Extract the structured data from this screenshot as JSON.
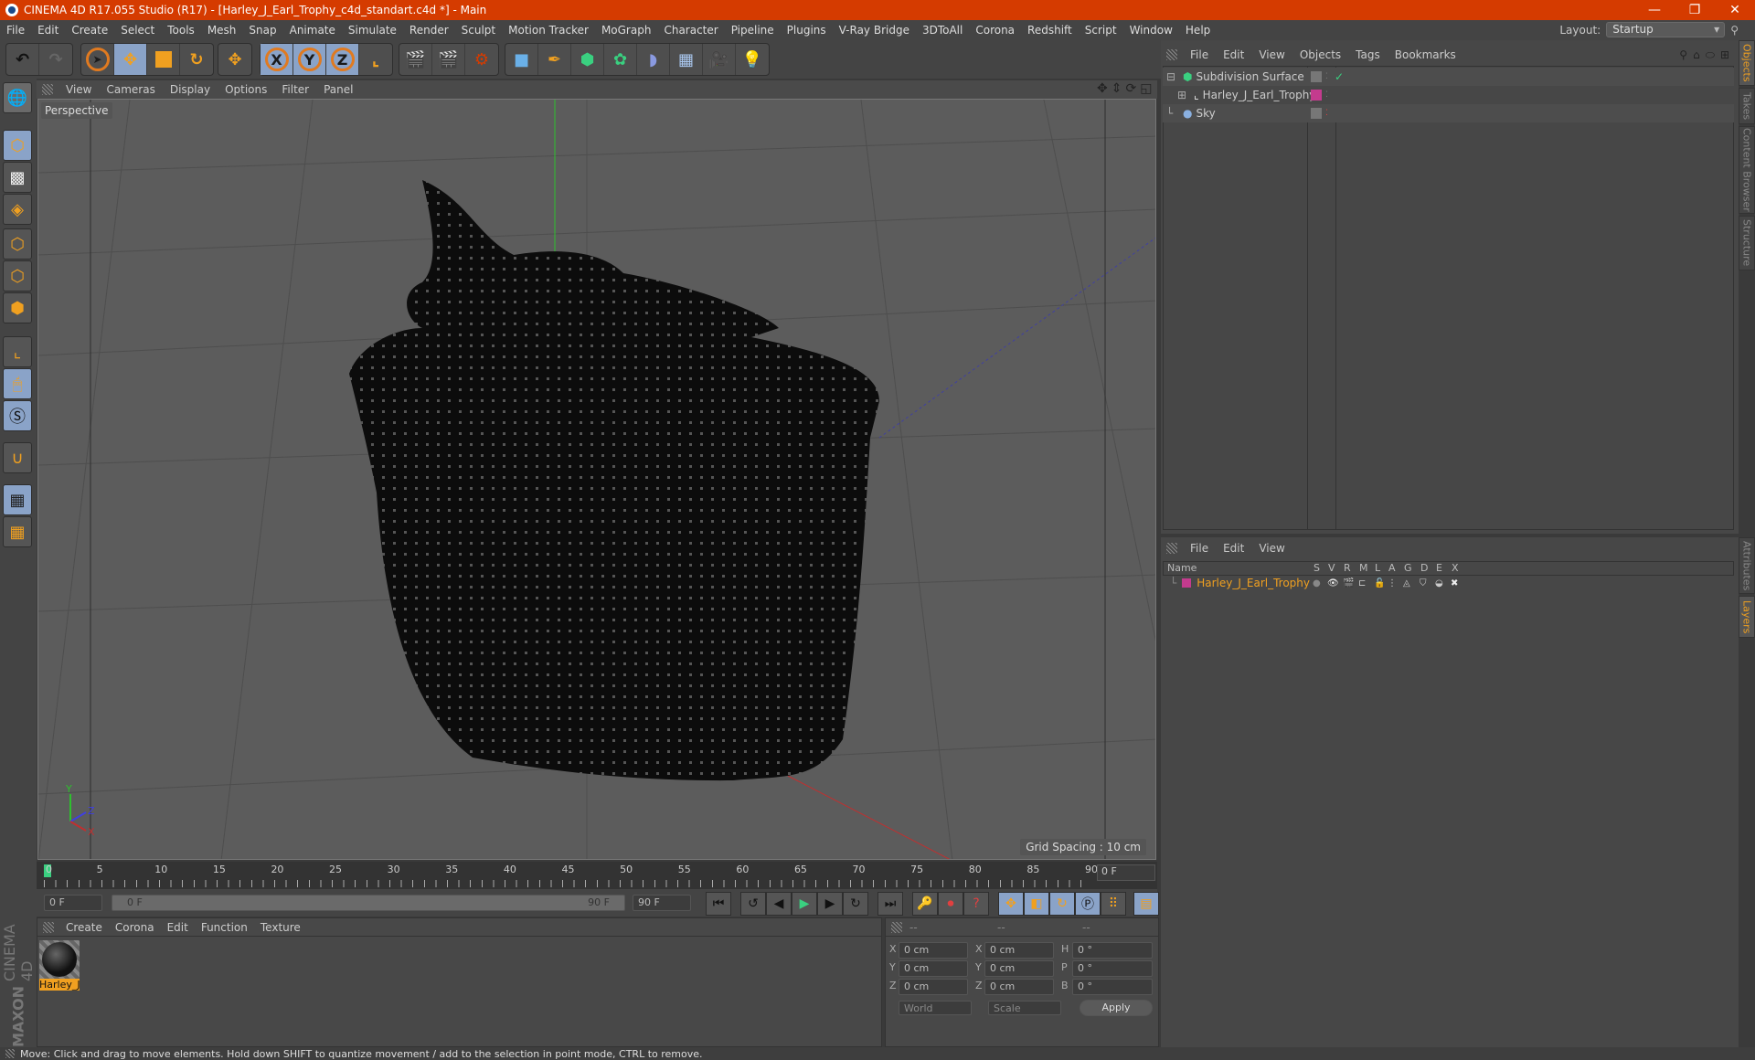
{
  "window": {
    "title": "CINEMA 4D R17.055 Studio (R17) - [Harley_J_Earl_Trophy_c4d_standart.c4d *] - Main",
    "controls": [
      "minimize",
      "restore",
      "close"
    ]
  },
  "menubar": [
    "File",
    "Edit",
    "Create",
    "Select",
    "Tools",
    "Mesh",
    "Snap",
    "Animate",
    "Simulate",
    "Render",
    "Sculpt",
    "Motion Tracker",
    "MoGraph",
    "Character",
    "Pipeline",
    "Plugins",
    "V-Ray Bridge",
    "3DToAll",
    "Corona",
    "Redshift",
    "Script",
    "Window",
    "Help"
  ],
  "layout": {
    "label": "Layout:",
    "value": "Startup"
  },
  "toolbar": {
    "history": [
      "undo-icon",
      "redo-icon"
    ],
    "modes": [
      "live-select-icon",
      "move-icon",
      "scale-icon",
      "rotate-icon",
      "transform-icon"
    ],
    "axes": [
      "X",
      "Y",
      "Z",
      "world-coordinate-icon"
    ],
    "render": [
      "render-view-icon",
      "render-picture-viewer-icon",
      "render-settings-icon"
    ],
    "create": [
      "cube-icon",
      "pen-icon",
      "subdivision-icon",
      "array-icon",
      "deformer-icon",
      "floor-icon",
      "camera-icon",
      "light-icon"
    ]
  },
  "left_tools": [
    "make-editable-icon",
    "model-mode-icon",
    "texture-mode-icon",
    "workplane-icon",
    "points-mode-icon",
    "edges-mode-icon",
    "polygons-mode-icon",
    "axis-icon",
    "tweak-icon",
    "solo-icon",
    "magnet-icon",
    "lock-workplane-icon",
    "snap-workplane-icon"
  ],
  "viewport": {
    "menu": [
      "View",
      "Cameras",
      "Display",
      "Options",
      "Filter",
      "Panel"
    ],
    "camera_label": "Perspective",
    "grid_spacing": "Grid Spacing : 10 cm",
    "axis_labels": [
      "Y",
      "Z",
      "X"
    ]
  },
  "timeline": {
    "ticks": [
      "0",
      "5",
      "10",
      "15",
      "20",
      "25",
      "30",
      "35",
      "40",
      "45",
      "50",
      "55",
      "60",
      "65",
      "70",
      "75",
      "80",
      "85",
      "90"
    ],
    "current_frame": "0 F",
    "start_field": "0 F",
    "range_start": "0 F",
    "range_end": "90 F",
    "end_field": "90 F"
  },
  "transport": [
    "go-to-start-icon",
    "previous-key-icon",
    "previous-frame-icon",
    "play-icon",
    "next-frame-icon",
    "next-key-icon",
    "go-to-end-icon",
    "record-disabled-icon",
    "autokey-icon",
    "keyframe-help-icon",
    "move-key-icon",
    "scale-key-icon",
    "rotate-key-icon",
    "param-key-icon",
    "pla-key-icon",
    "timeline-icon"
  ],
  "materials": {
    "menu": [
      "Create",
      "Corona",
      "Edit",
      "Function",
      "Texture"
    ],
    "items": [
      {
        "name": "Harley_J"
      }
    ]
  },
  "coordinates": {
    "headers": [
      "--",
      "--",
      "--"
    ],
    "rows": [
      {
        "a": "X",
        "av": "0 cm",
        "b": "X",
        "bv": "0 cm",
        "c": "H",
        "cv": "0 °"
      },
      {
        "a": "Y",
        "av": "0 cm",
        "b": "Y",
        "bv": "0 cm",
        "c": "P",
        "cv": "0 °"
      },
      {
        "a": "Z",
        "av": "0 cm",
        "b": "Z",
        "bv": "0 cm",
        "c": "B",
        "cv": "0 °"
      }
    ],
    "mode": "World",
    "type": "Scale",
    "apply": "Apply"
  },
  "object_manager": {
    "menu": [
      "File",
      "Edit",
      "View",
      "Objects",
      "Tags",
      "Bookmarks"
    ],
    "objects": [
      {
        "name": "Subdivision Surface",
        "icon": "subdivision-icon",
        "tag": "checkmark"
      },
      {
        "name": "Harley_J_Earl_Trophy",
        "icon": "null-object-icon",
        "color": "#c43b8e"
      },
      {
        "name": "Sky",
        "icon": "sky-icon"
      }
    ]
  },
  "layer_manager": {
    "menu": [
      "File",
      "Edit",
      "View"
    ],
    "columns": [
      "Name",
      "S",
      "V",
      "R",
      "M",
      "L",
      "A",
      "G",
      "D",
      "E",
      "X"
    ],
    "layers": [
      {
        "name": "Harley_J_Earl_Trophy",
        "color": "#c43b8e"
      }
    ]
  },
  "side_tabs_top": [
    "Objects",
    "Takes",
    "Content Browser",
    "Structure"
  ],
  "side_tabs_bottom": [
    "Attributes",
    "Layers"
  ],
  "branding": {
    "maxon": "MAXON",
    "product": "CINEMA 4D"
  },
  "status": "Move: Click and drag to move elements. Hold down SHIFT to quantize movement / add to the selection in point mode, CTRL to remove.",
  "colors": {
    "title_bar": "#d53b00",
    "accent": "#f0a020",
    "active_button": "#8aa3c8"
  }
}
